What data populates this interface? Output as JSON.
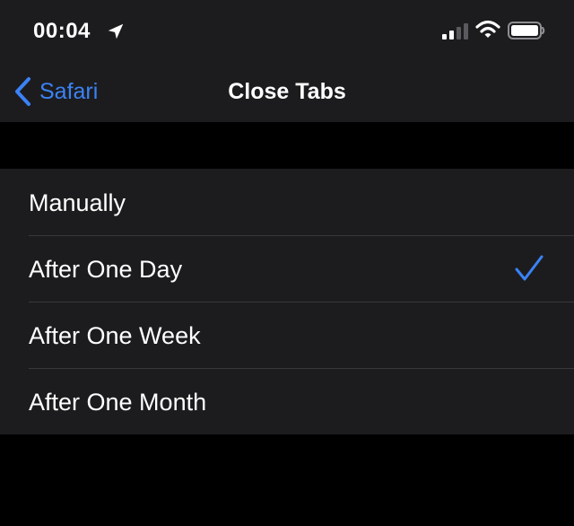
{
  "status_bar": {
    "time": "00:04",
    "icons": [
      "location-arrow-icon",
      "signal-bars-icon",
      "wifi-icon",
      "battery-icon"
    ]
  },
  "nav": {
    "back_label": "Safari",
    "title": "Close Tabs"
  },
  "options": [
    {
      "label": "Manually",
      "selected": false
    },
    {
      "label": "After One Day",
      "selected": true
    },
    {
      "label": "After One Week",
      "selected": false
    },
    {
      "label": "After One Month",
      "selected": false
    }
  ],
  "colors": {
    "background": "#000000",
    "surface": "#1c1c1e",
    "separator": "#38383a",
    "accent": "#3b82f6",
    "text": "#ffffff"
  }
}
